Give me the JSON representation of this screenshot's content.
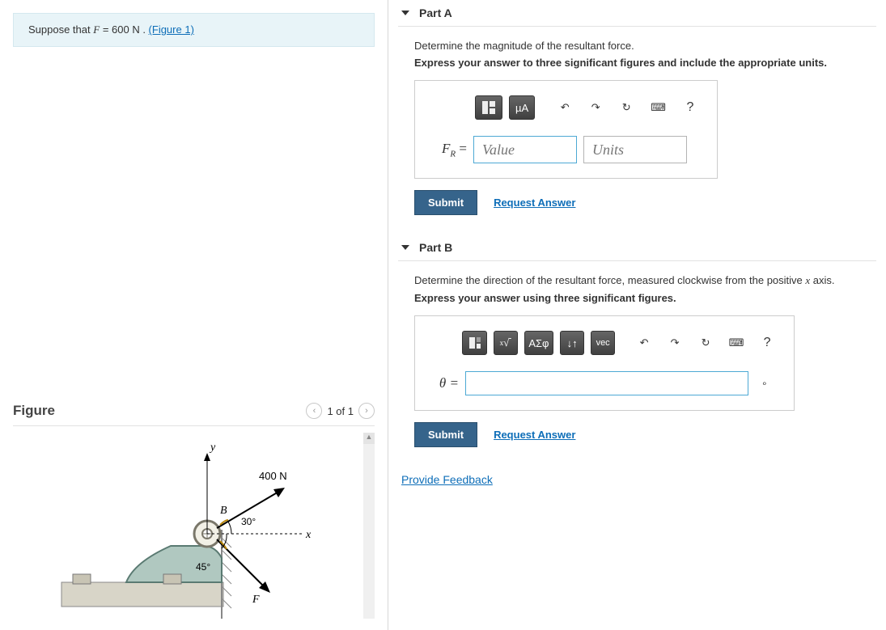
{
  "problem": {
    "suppose_prefix": "Suppose that ",
    "variable": "F",
    "equals": " = 600  N . ",
    "figure_link": "(Figure 1)"
  },
  "figure": {
    "title": "Figure",
    "pager": "1 of 1",
    "labels": {
      "y": "y",
      "x": "x",
      "B": "B",
      "F": "F",
      "force400": "400 N",
      "angle30": "30°",
      "angle45": "45°"
    }
  },
  "partA": {
    "title": "Part A",
    "prompt": "Determine the magnitude of the resultant force.",
    "hint": "Express your answer to three significant figures and include the appropriate units.",
    "toolbar": {
      "templates": "▮",
      "units": "µA",
      "undo": "↶",
      "redo": "↷",
      "reset": "↻",
      "keyboard": "⌨",
      "help": "?"
    },
    "eq_label_var": "F",
    "eq_label_sub": "R",
    "eq_label_eq": " = ",
    "value_placeholder": "Value",
    "units_placeholder": "Units",
    "submit": "Submit",
    "request": "Request Answer"
  },
  "partB": {
    "title": "Part B",
    "prompt_pre": "Determine the direction of the resultant force, measured clockwise from the positive ",
    "prompt_var": "x",
    "prompt_post": " axis.",
    "hint": "Express your answer using three significant figures.",
    "toolbar": {
      "fmt": "▮",
      "sqrt": "√",
      "greek": "ΑΣφ",
      "subsup": "↓↑",
      "vec": "vec",
      "undo": "↶",
      "redo": "↷",
      "reset": "↻",
      "keyboard": "⌨",
      "help": "?"
    },
    "eq_label": "θ = ",
    "unit_suffix": "∘",
    "submit": "Submit",
    "request": "Request Answer"
  },
  "feedback": "Provide Feedback"
}
